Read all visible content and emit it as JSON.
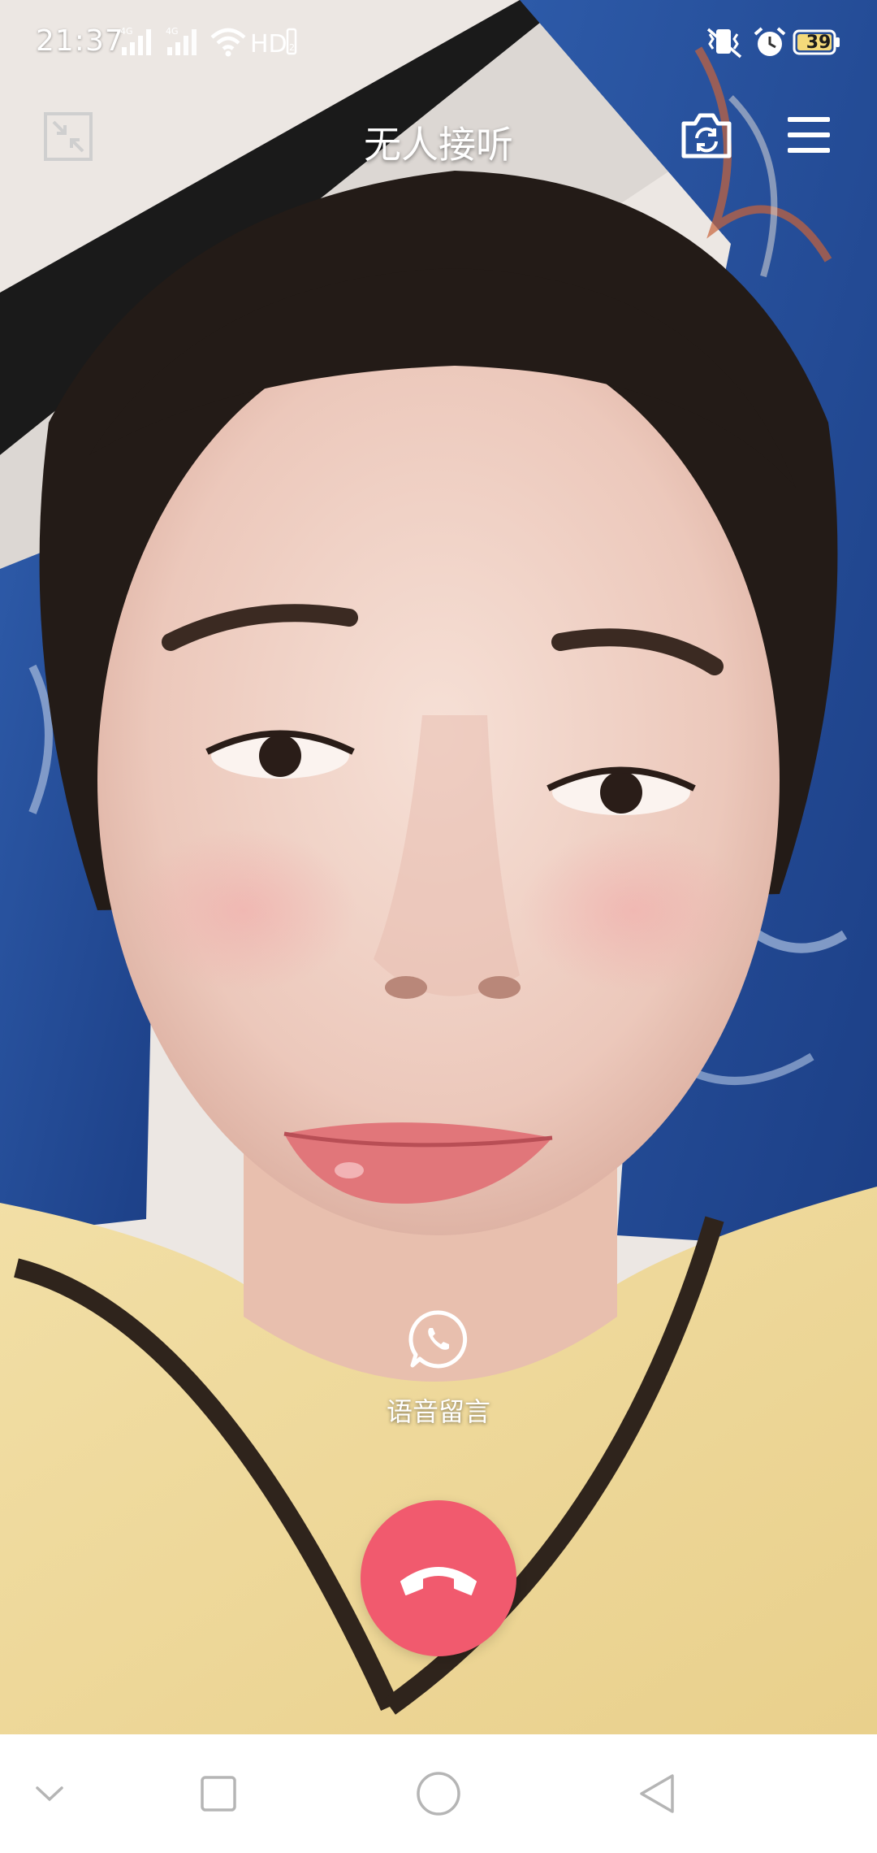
{
  "status_bar": {
    "time": "21:37",
    "battery": "39",
    "icons": [
      "signal-4g-icon",
      "signal-4g-icon",
      "wifi-icon",
      "hd-icon",
      "vibrate-icon",
      "alarm-icon",
      "battery-icon"
    ]
  },
  "call": {
    "status_text": "无人接听",
    "minimize_icon": "minimize-icon",
    "switch_camera_icon": "switch-camera-icon",
    "menu_icon": "menu-icon"
  },
  "voice_message": {
    "label": "语音留言",
    "icon": "phone-chat-icon"
  },
  "hangup": {
    "icon": "hangup-icon",
    "color": "#f15a6e"
  },
  "nav_bar": {
    "items": [
      "chevron-down-icon",
      "recents-icon",
      "home-icon",
      "back-icon"
    ]
  }
}
